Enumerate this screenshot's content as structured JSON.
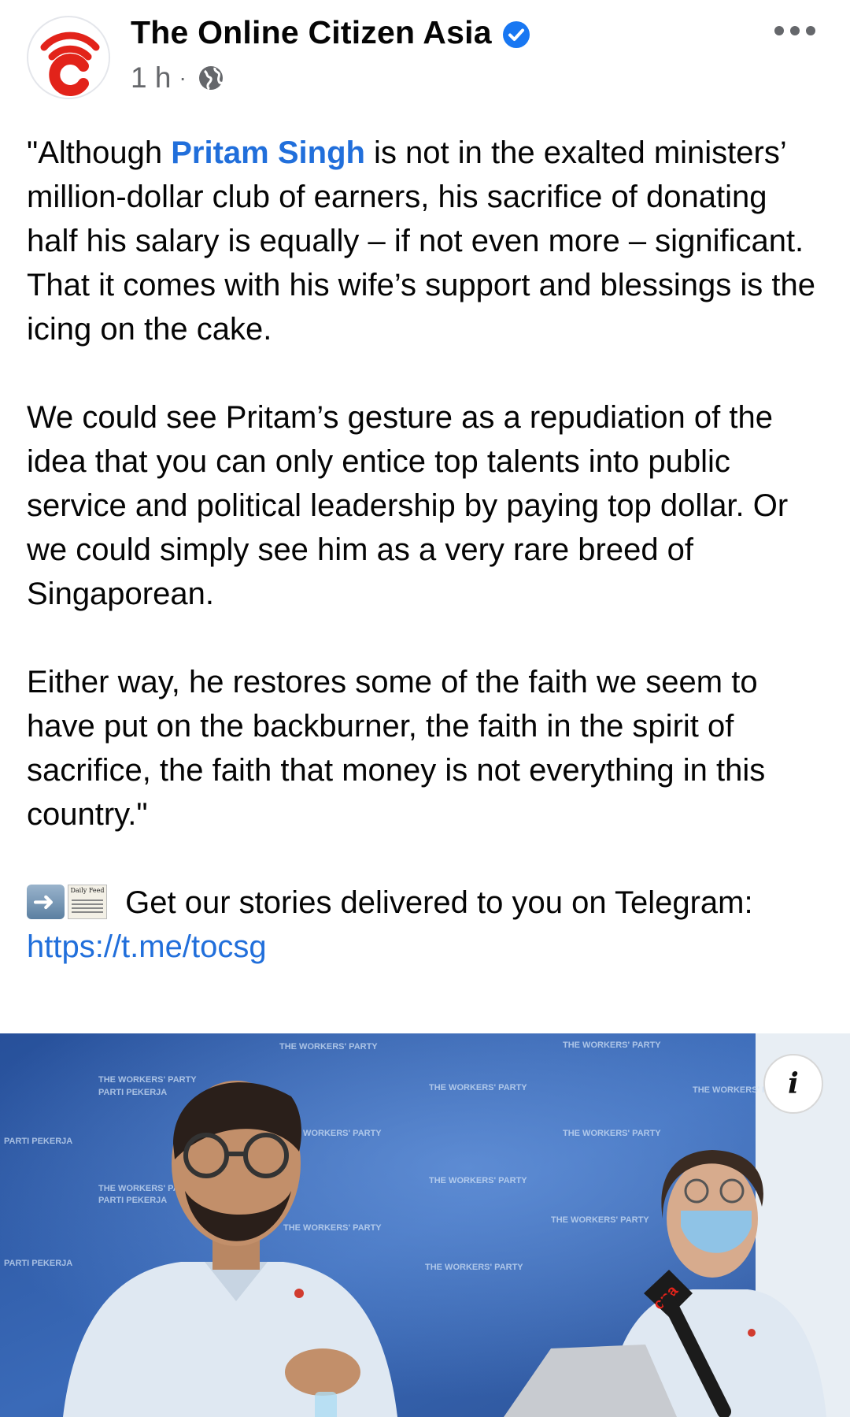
{
  "post": {
    "page_name": "The Online Citizen Asia",
    "time": "1 h",
    "separator": "·",
    "icons": {
      "avatar": "toc-logo",
      "verified": "verified-badge-icon",
      "privacy": "globe-icon",
      "menu": "more-horizontal-icon"
    },
    "paragraph1": {
      "before_mention": "\"Although ",
      "mention": "Pritam Singh",
      "after_mention": " is not in the exalted ministers’ million-dollar club of earners, his sacrifice of donating half his salary is equally – if not even more – significant. That it comes with his wife’s support and blessings is the icing on the cake."
    },
    "paragraph2": "We could see Pritam’s gesture as a repudiation of the idea that you can only entice top talents into public service and political leadership by paying top dollar. Or we could simply see him as a very rare breed of Singaporean.",
    "paragraph3": "Either way, he restores some of the faith we seem to have put on the backburner, the faith in the spirit of sacrifice, the faith that money is not everything in this country.\"",
    "cta": {
      "emoji_1": "right-arrow-emoji",
      "emoji_2": "newspaper-emoji",
      "emoji_2_text": "Daily Feed",
      "text": " Get our stories delivered to you on Telegram: ",
      "link": "https://t.me/tocsg"
    },
    "photo": {
      "info_label": "i",
      "banner_text": "THE WORKERS' PARTY",
      "banner_text_2": "PARTI PEKERJA",
      "mic_brand": "cna"
    }
  },
  "colors": {
    "link": "#216fdb",
    "verified": "#1877f2",
    "secondary_text": "#65676b",
    "brand_red": "#e2231a",
    "backdrop_blue": "#2f5aa0"
  }
}
